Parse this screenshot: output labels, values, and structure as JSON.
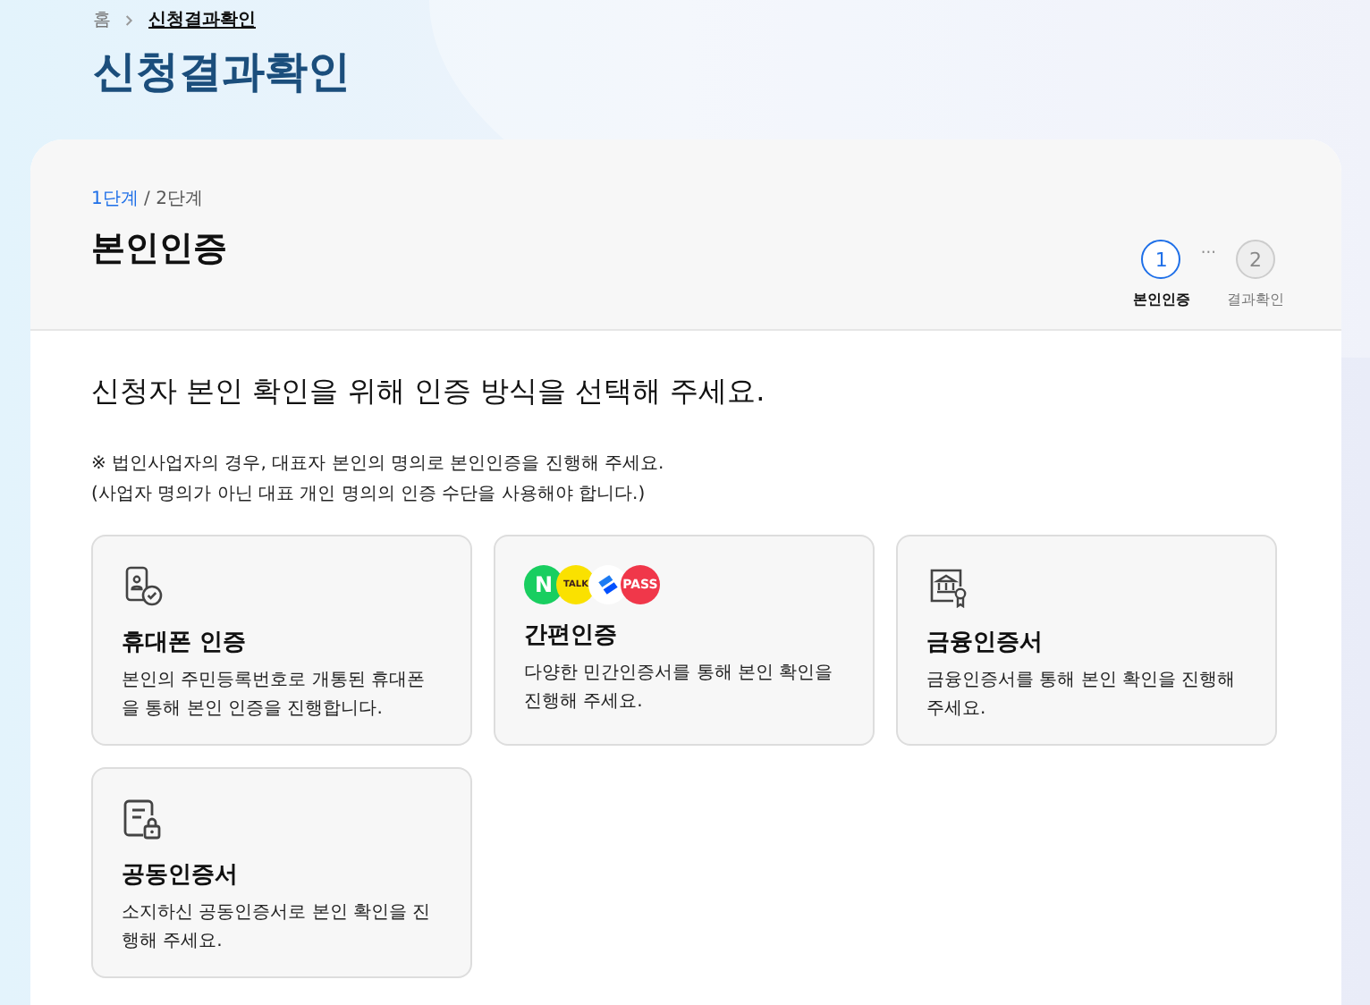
{
  "breadcrumb": [
    {
      "label": "홈",
      "current": false
    },
    {
      "label": "신청결과확인",
      "current": true
    }
  ],
  "page_title": "신청결과확인",
  "step_text": {
    "current": "1단계",
    "total": "/ 2단계"
  },
  "section_title": "본인인증",
  "steps": [
    {
      "number": "1",
      "label": "본인인증",
      "selected": true
    },
    {
      "number": "2",
      "label": "결과확인",
      "selected": false
    }
  ],
  "step_separator": "···",
  "heading": "신청자 본인 확인을 위해 인증 방식을 선택해 주세요.",
  "notes": [
    "※ 법인사업자의 경우, 대표자 본인의 명의로 본인인증을 진행해 주세요.",
    "(사업자 명의가 아닌 대표 개인 명의의 인증 수단을 사용해야 합니다.)"
  ],
  "methods": [
    {
      "kind": "phone",
      "title": "휴대폰 인증",
      "description": "본인의 주민등록번호로 개통된 휴대폰을 통해 본인 인증을 진행합니다."
    },
    {
      "kind": "logos",
      "title": "간편인증",
      "description": "다양한 민간인증서를 통해 본인 확인을 진행해 주세요.",
      "logos": [
        {
          "kind": "lettered",
          "label": "N",
          "color": "#19ce60"
        },
        {
          "kind": "lettered",
          "label": "TALK",
          "color": "#fae100"
        },
        {
          "kind": "mark",
          "color": "#ffffff"
        },
        {
          "kind": "lettered",
          "label": "PASS",
          "color": "#f0374a"
        }
      ]
    },
    {
      "kind": "bank",
      "title": "금융인증서",
      "description": "금융인증서를 통해 본인 확인을 진행해 주세요."
    },
    {
      "kind": "document",
      "title": "공동인증서",
      "description": "소지하신 공동인증서로 본인 확인을 진행해 주세요."
    }
  ]
}
